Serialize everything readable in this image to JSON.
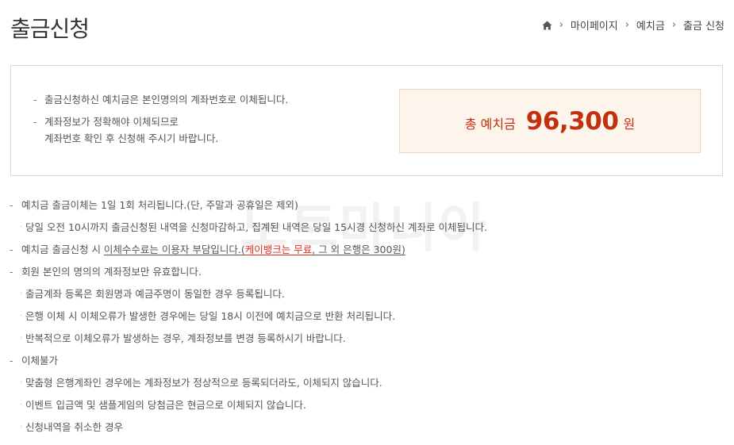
{
  "page": {
    "title": "출금신청"
  },
  "breadcrumb": {
    "items": [
      "마이페이지",
      "예치금",
      "출금 신청"
    ]
  },
  "summary": {
    "notices": [
      {
        "lines": [
          "출금신청하신 예치금은 본인명의의 계좌번호로 이체됩니다."
        ]
      },
      {
        "lines": [
          "계좌정보가 정확해야 이체되므로",
          "계좌번호 확인 후 신청해 주시기 바랍니다."
        ]
      }
    ],
    "deposit": {
      "label": "총 예치금",
      "amount": "96,300",
      "unit": "원"
    }
  },
  "rules": {
    "r1": "예치금 출금이체는 1일 1회 처리됩니다.(단, 주말과 공휴일은 제외)",
    "r1_sub": "당일 오전 10시까지 출금신청된 내역을 신청마감하고, 집계된 내역은 당일 15시경 신청하신 계좌로 이체됩니다.",
    "r2_prefix": "예치금 출금신청 시 ",
    "r2_under": "이체수수료는 이용자 부담입니다.",
    "r2_paren_open": "(",
    "r2_red": "케이뱅크는 무료",
    "r2_rest": ", 그 외 은행은 300원)",
    "r3": "회원 본인의 명의의 계좌정보만 유효합니다.",
    "r3_subs": [
      "출금계좌 등록은 회원명과 예금주명이 동일한 경우 등록됩니다.",
      "은행 이체 시 이체오류가 발생한 경우에는 당일 18시 이전에 예치금으로 반환 처리됩니다.",
      "반복적으로 이체오류가 발생하는 경우, 계좌정보를 변경 등록하시기 바랍니다."
    ],
    "r4": "이체불가",
    "r4_subs": [
      "맞춤형 은행계좌인 경우에는 계좌정보가 정상적으로 등록되더라도, 이체되지 않습니다.",
      "이벤트 입금액 및 샘플게임의 당첨금은 현금으로 이체되지 않습니다.",
      "신청내역을 취소한 경우"
    ]
  },
  "watermark": "노트마니아",
  "colors": {
    "accent": "#c2310f",
    "highlight": "#e52a1a",
    "panel_bg": "#fdf4ec"
  }
}
